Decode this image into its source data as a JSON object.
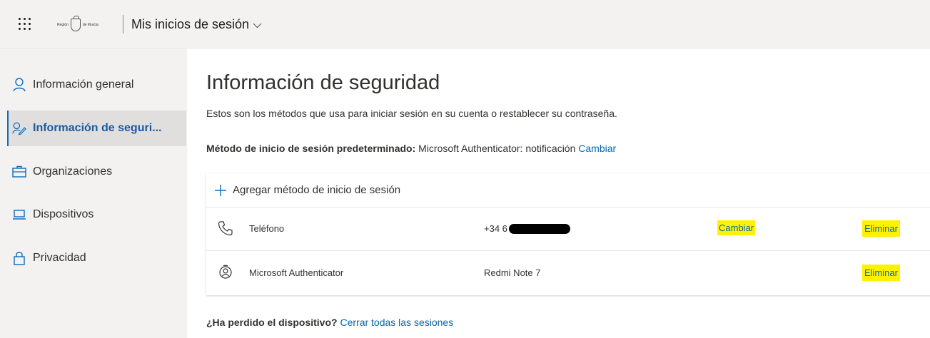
{
  "header": {
    "logo_text_left": "Región",
    "logo_text_right": "de Murcia",
    "app_title": "Mis inicios de sesión"
  },
  "sidebar": {
    "items": [
      {
        "label": "Información general",
        "icon": "person-icon",
        "active": false
      },
      {
        "label": "Información de seguri...",
        "icon": "security-info-icon",
        "active": true
      },
      {
        "label": "Organizaciones",
        "icon": "briefcase-icon",
        "active": false
      },
      {
        "label": "Dispositivos",
        "icon": "laptop-icon",
        "active": false
      },
      {
        "label": "Privacidad",
        "icon": "lock-icon",
        "active": false
      }
    ]
  },
  "main": {
    "title": "Información de seguridad",
    "description": "Estos son los métodos que usa para iniciar sesión en su cuenta o restablecer su contraseña.",
    "default_method": {
      "label": "Método de inicio de sesión predeterminado:",
      "value": "Microsoft Authenticator: notificación",
      "change_link": "Cambiar"
    },
    "add_method_label": "Agregar método de inicio de sesión",
    "methods": [
      {
        "icon": "phone-icon",
        "name": "Teléfono",
        "value": "+34 6",
        "redacted": true,
        "change": "Cambiar",
        "remove": "Eliminar"
      },
      {
        "icon": "authenticator-icon",
        "name": "Microsoft Authenticator",
        "value": "Redmi Note 7",
        "redacted": false,
        "change": "",
        "remove": "Eliminar"
      }
    ],
    "lost_device": {
      "question": "¿Ha perdido el dispositivo?",
      "link": "Cerrar todas las sesiones"
    }
  },
  "colors": {
    "link": "#0067b8",
    "active_nav_text": "#1a5aa0",
    "highlight": "#fff200",
    "sidebar_bg": "#f3f2f1"
  }
}
